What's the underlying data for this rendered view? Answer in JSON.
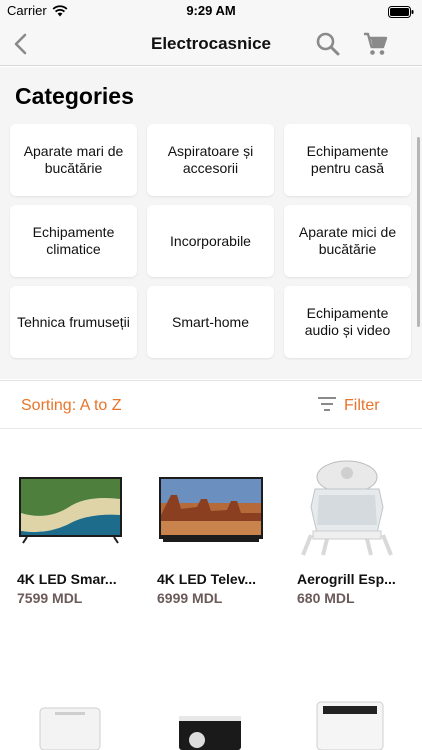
{
  "status_bar": {
    "carrier": "Carrier",
    "time": "9:29 AM"
  },
  "nav": {
    "title": "Electrocasnice"
  },
  "categories": {
    "title": "Categories",
    "items": [
      {
        "label": "Aparate mari de bucătărie"
      },
      {
        "label": "Aspiratoare și accesorii"
      },
      {
        "label": "Echipamente pentru casă"
      },
      {
        "label": "Echipamente climatice"
      },
      {
        "label": "Incorporabile"
      },
      {
        "label": "Aparate mici de bucătărie"
      },
      {
        "label": "Tehnica frumuseții"
      },
      {
        "label": "Smart-home"
      },
      {
        "label": "Echipamente audio și video"
      }
    ]
  },
  "sort_bar": {
    "sort_label": "Sorting: A to Z",
    "filter_label": "Filter"
  },
  "products": [
    {
      "name": "4K LED Smar...",
      "price": "7599 MDL"
    },
    {
      "name": "4K LED Telev...",
      "price": "6999 MDL"
    },
    {
      "name": "Aerogrill Esp...",
      "price": "680 MDL"
    }
  ],
  "colors": {
    "accent": "#e8752b",
    "price": "#6b5a5a",
    "section_bg": "#f5f5f5"
  }
}
